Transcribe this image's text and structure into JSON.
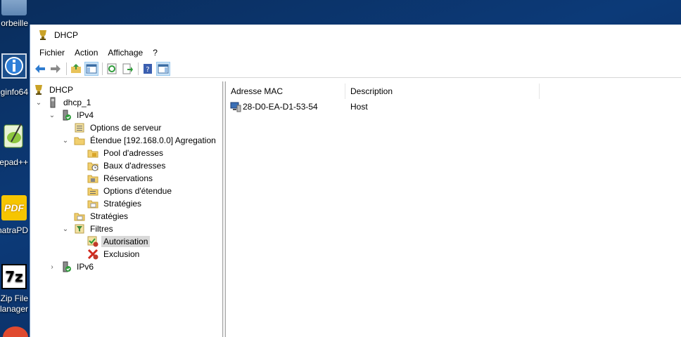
{
  "desktop": {
    "items": [
      {
        "label": "orbeille"
      },
      {
        "label": "ginfo64"
      },
      {
        "label": "tepad++"
      },
      {
        "label": "natraPD"
      },
      {
        "label1": "Zip File",
        "label2": "lanager"
      }
    ],
    "pdf_badge": "PDF",
    "zip_badge": "7z"
  },
  "window": {
    "title": "DHCP",
    "menu": [
      "Fichier",
      "Action",
      "Affichage",
      "?"
    ]
  },
  "tree": {
    "root": "DHCP",
    "server": "dhcp_1",
    "ipv4": "IPv4",
    "server_options": "Options de serveur",
    "scope": "Étendue [192.168.0.0] Agregation",
    "address_pool": "Pool d'adresses",
    "address_leases": "Baux d'adresses",
    "reservations": "Réservations",
    "scope_options": "Options d'étendue",
    "scope_policies": "Stratégies",
    "policies": "Stratégies",
    "filters": "Filtres",
    "allow": "Autorisation",
    "deny": "Exclusion",
    "ipv6": "IPv6"
  },
  "list": {
    "columns": [
      "Adresse MAC",
      "Description"
    ],
    "rows": [
      {
        "mac": "28-D0-EA-D1-53-54",
        "description": "Host"
      }
    ]
  }
}
